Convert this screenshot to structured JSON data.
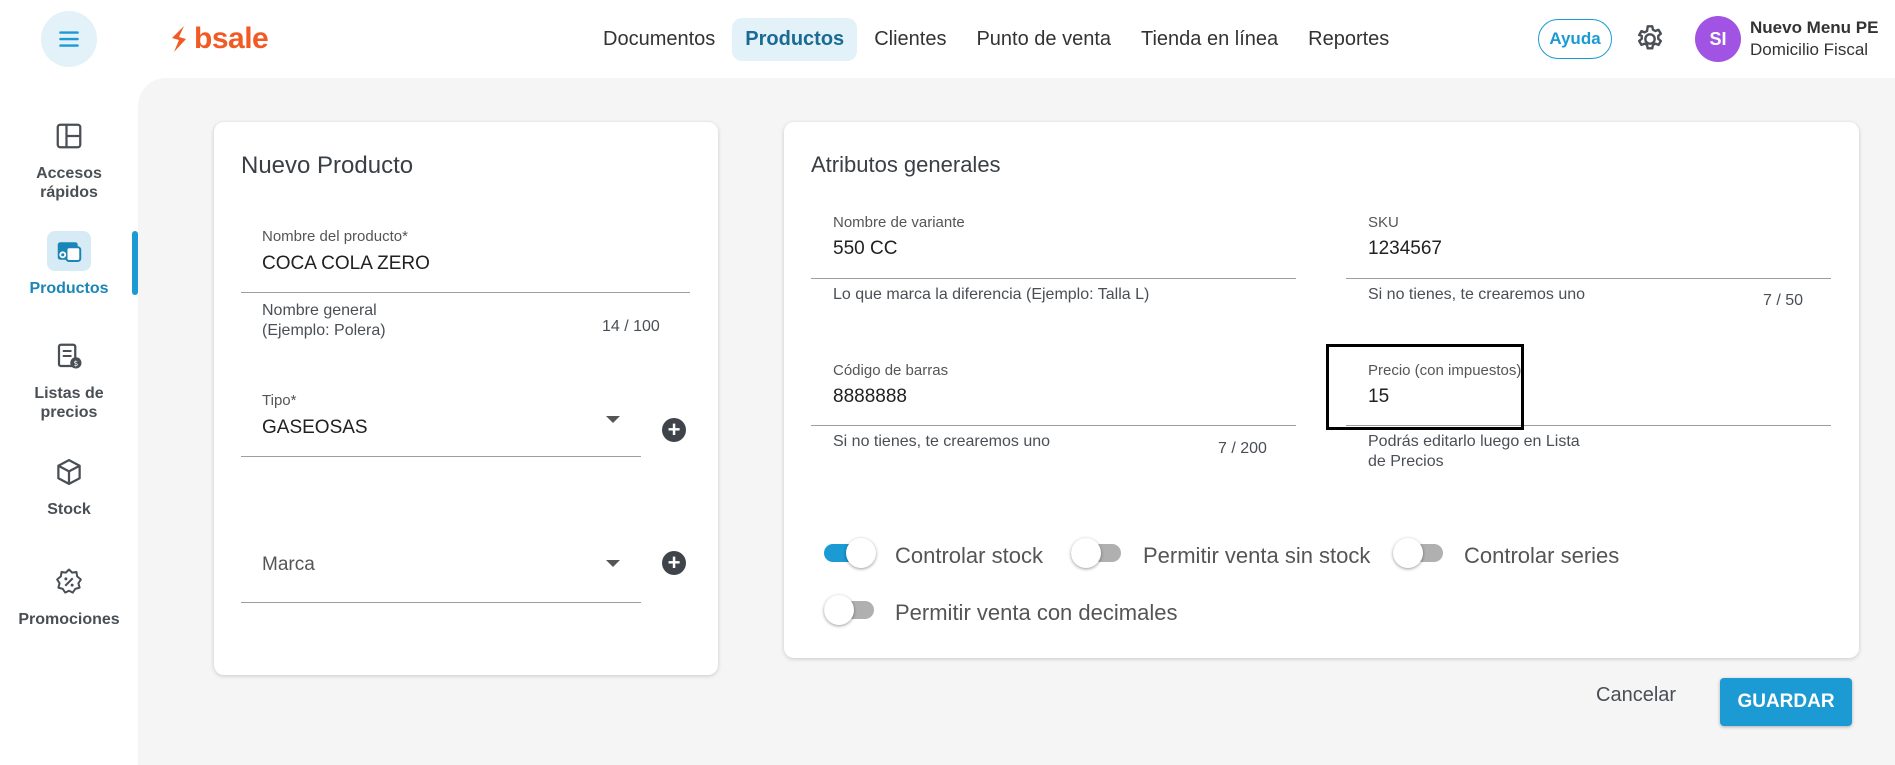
{
  "header": {
    "logo_text": "bsale",
    "nav": [
      {
        "label": "Documentos"
      },
      {
        "label": "Productos"
      },
      {
        "label": "Clientes"
      },
      {
        "label": "Punto de venta"
      },
      {
        "label": "Tienda en línea"
      },
      {
        "label": "Reportes"
      }
    ],
    "active_nav": "Productos",
    "help_label": "Ayuda",
    "avatar_initials": "SI",
    "user_name": "Nuevo Menu PE",
    "user_sub": "Domicilio Fiscal"
  },
  "sidebar": {
    "items": [
      {
        "label": "Accesos rápidos",
        "icon": "layout-icon"
      },
      {
        "label": "Productos",
        "icon": "products-icon"
      },
      {
        "label": "Listas de precios",
        "icon": "price-list-icon"
      },
      {
        "label": "Stock",
        "icon": "box-icon"
      },
      {
        "label": "Promociones",
        "icon": "discount-icon"
      }
    ],
    "active": "Productos"
  },
  "new_product": {
    "title": "Nuevo Producto",
    "name_label": "Nombre del producto*",
    "name_value": "COCA COLA ZERO",
    "name_hint": "Nombre general (Ejemplo: Polera)",
    "name_counter": "14 / 100",
    "type_label": "Tipo*",
    "type_value": "GASEOSAS",
    "brand_placeholder": "Marca"
  },
  "attributes": {
    "title": "Atributos generales",
    "variant_label": "Nombre de variante",
    "variant_value": "550 CC",
    "variant_hint": "Lo que marca la diferencia (Ejemplo: Talla L)",
    "sku_label": "SKU",
    "sku_value": "1234567",
    "sku_hint": "Si no tienes, te crearemos uno",
    "sku_counter": "7 / 50",
    "barcode_label": "Código de barras",
    "barcode_value": "8888888",
    "barcode_hint": "Si no tienes, te crearemos uno",
    "barcode_counter": "7 / 200",
    "price_label": "Precio (con impuestos)",
    "price_value": "15",
    "price_hint": "Podrás editarlo luego en Lista de Precios"
  },
  "toggles": [
    {
      "label": "Controlar stock",
      "on": true
    },
    {
      "label": "Permitir venta sin stock",
      "on": false
    },
    {
      "label": "Controlar series",
      "on": false
    },
    {
      "label": "Permitir venta con decimales",
      "on": false
    }
  ],
  "actions": {
    "cancel_label": "Cancelar",
    "save_label": "GUARDAR"
  },
  "colors": {
    "accent": "#1b9ad3",
    "brand": "#f15a24",
    "avatar": "#a154e3"
  }
}
